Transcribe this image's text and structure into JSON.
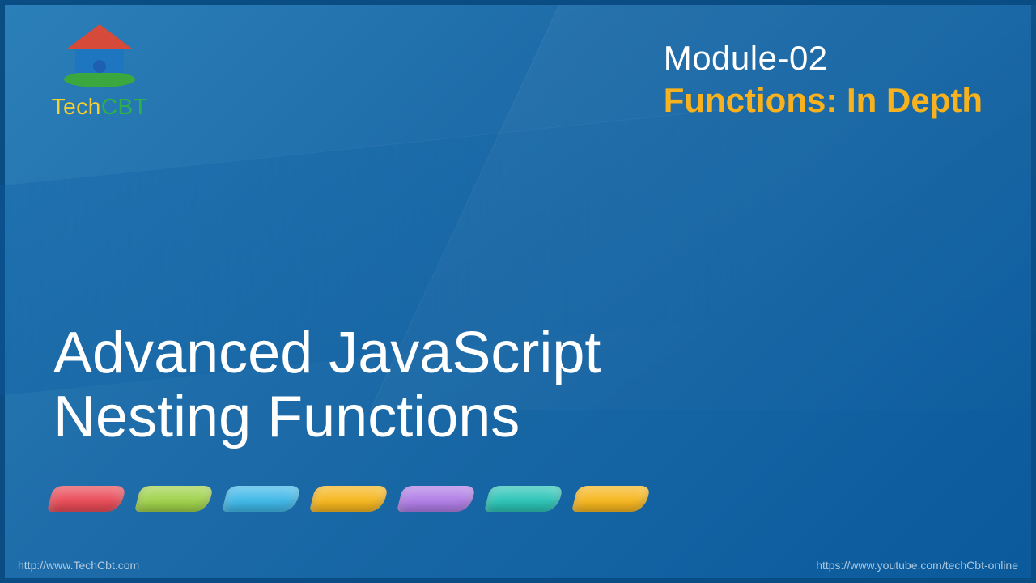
{
  "logo": {
    "word1": "Tech",
    "word2": "CBT"
  },
  "header": {
    "module_label": "Module-02",
    "module_title": "Functions: In Depth"
  },
  "main": {
    "course_title": "Advanced JavaScript",
    "topic_title": "Nesting Functions"
  },
  "pills": [
    {
      "color": "#e94b57"
    },
    {
      "color": "#9fd24a"
    },
    {
      "color": "#3fb8e8"
    },
    {
      "color": "#f6b61e"
    },
    {
      "color": "#b07de6"
    },
    {
      "color": "#2bc4b6"
    },
    {
      "color": "#f6b61e"
    }
  ],
  "footer": {
    "left_url": "http://www.TechCbt.com",
    "right_url": "https://www.youtube.com/techCbt-online"
  }
}
